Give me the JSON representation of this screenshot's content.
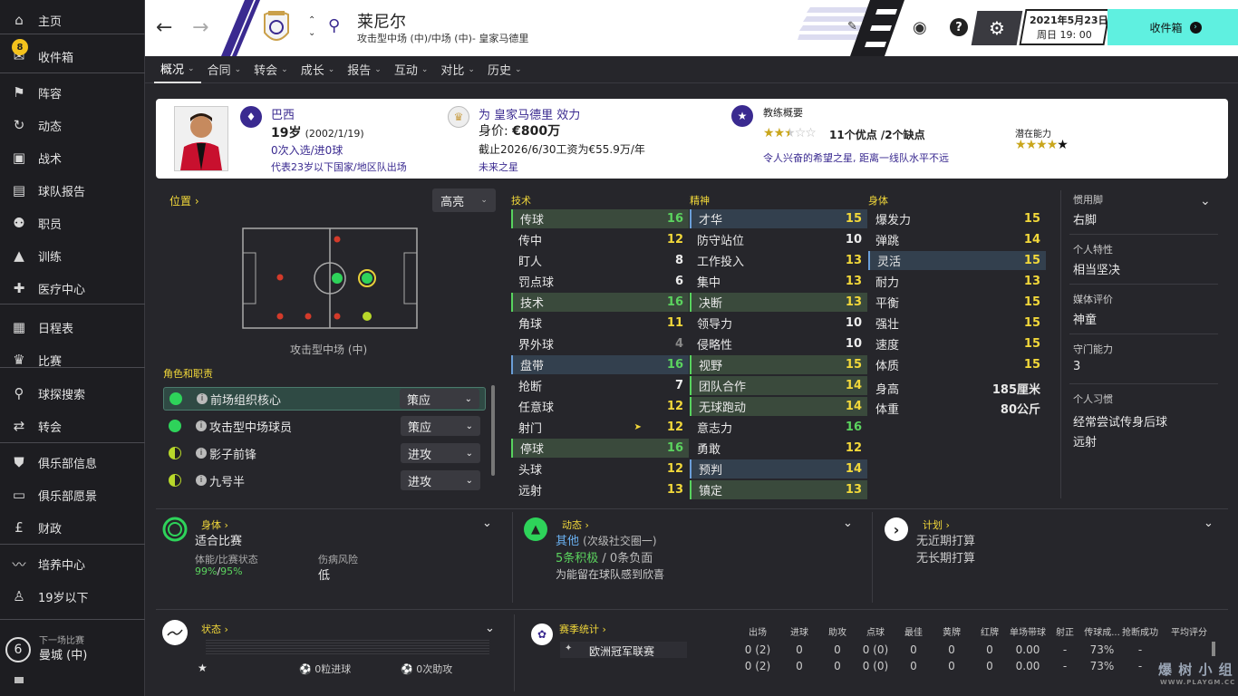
{
  "sidebar": {
    "items": [
      {
        "label": "主页",
        "icon": "home-icon"
      },
      {
        "label": "收件箱",
        "icon": "inbox-icon",
        "badge": "8"
      },
      {
        "label": "阵容",
        "icon": "squad-icon"
      },
      {
        "label": "动态",
        "icon": "dynamics-icon"
      },
      {
        "label": "战术",
        "icon": "tactics-icon"
      },
      {
        "label": "球队报告",
        "icon": "report-icon"
      },
      {
        "label": "职员",
        "icon": "staff-icon"
      },
      {
        "label": "训练",
        "icon": "training-icon"
      },
      {
        "label": "医疗中心",
        "icon": "medical-icon"
      },
      {
        "label": "日程表",
        "icon": "calendar-icon"
      },
      {
        "label": "比赛",
        "icon": "trophy-icon"
      },
      {
        "label": "球探搜索",
        "icon": "search-icon"
      },
      {
        "label": "转会",
        "icon": "transfer-icon"
      },
      {
        "label": "俱乐部信息",
        "icon": "shield-icon"
      },
      {
        "label": "俱乐部愿景",
        "icon": "briefcase-icon"
      },
      {
        "label": "财政",
        "icon": "money-icon"
      },
      {
        "label": "培养中心",
        "icon": "development-icon"
      },
      {
        "label": "19岁以下",
        "icon": "youth-icon"
      }
    ],
    "next_match": {
      "label": "下一场比赛",
      "days": "6",
      "opponent": "曼城 (中)"
    }
  },
  "header": {
    "player_name": "莱尼尔",
    "position_line": "攻击型中场 (中)/中场 (中)- 皇家马德里",
    "date": "2021年5月23日",
    "time": "周日 19: 00",
    "inbox_label": "收件箱"
  },
  "tabs": [
    "概况",
    "合同",
    "转会",
    "成长",
    "报告",
    "互动",
    "对比",
    "历史"
  ],
  "info": {
    "nationality": "巴西",
    "age": "19岁",
    "dob": "(2002/1/19)",
    "caps": "0次入选/进0球",
    "intl": "代表23岁以下国家/地区队出场",
    "club_line": "为 皇家马德里 效力",
    "value_label": "身价: ",
    "value": "€800万",
    "contract": "截止2026/6/30工资为€55.9万/年",
    "future": "未来之星",
    "coach_title": "教练概要",
    "strengths": "11个优点 /2个缺点",
    "coach_note": "令人兴奋的希望之星, 距离一线队水平不远",
    "potential_label": "潜在能力",
    "current_stars": 2.5,
    "potential_stars": 4.5
  },
  "position": {
    "title": "位置",
    "dropdown": "高亮",
    "label": "攻击型中场 (中)",
    "roles_title": "角色和职责",
    "roles": [
      {
        "name": "前场组织核心",
        "duty": "策应",
        "color": "#2ed35a"
      },
      {
        "name": "攻击型中场球员",
        "duty": "策应",
        "color": "#2ed35a"
      },
      {
        "name": "影子前锋",
        "duty": "进攻",
        "color": "#b8d82a"
      },
      {
        "name": "九号半",
        "duty": "进攻",
        "color": "#b8d82a"
      }
    ]
  },
  "attributes": {
    "technical_title": "技术",
    "mental_title": "精神",
    "physical_title": "身体",
    "technical": [
      {
        "n": "传球",
        "v": 16,
        "hl": "g"
      },
      {
        "n": "传中",
        "v": 12
      },
      {
        "n": "盯人",
        "v": 8
      },
      {
        "n": "罚点球",
        "v": 6
      },
      {
        "n": "技术",
        "v": 16,
        "hl": "g"
      },
      {
        "n": "角球",
        "v": 11
      },
      {
        "n": "界外球",
        "v": 4
      },
      {
        "n": "盘带",
        "v": 16,
        "hl": "b"
      },
      {
        "n": "抢断",
        "v": 7
      },
      {
        "n": "任意球",
        "v": 12
      },
      {
        "n": "射门",
        "v": 12,
        "arrow": true
      },
      {
        "n": "停球",
        "v": 16,
        "hl": "g"
      },
      {
        "n": "头球",
        "v": 12
      },
      {
        "n": "远射",
        "v": 13
      }
    ],
    "mental": [
      {
        "n": "才华",
        "v": 15,
        "hl": "b"
      },
      {
        "n": "防守站位",
        "v": 10
      },
      {
        "n": "工作投入",
        "v": 13
      },
      {
        "n": "集中",
        "v": 13
      },
      {
        "n": "决断",
        "v": 13,
        "hl": "g"
      },
      {
        "n": "领导力",
        "v": 10
      },
      {
        "n": "侵略性",
        "v": 10
      },
      {
        "n": "视野",
        "v": 15,
        "hl": "g"
      },
      {
        "n": "团队合作",
        "v": 14,
        "hl": "g"
      },
      {
        "n": "无球跑动",
        "v": 14,
        "hl": "g"
      },
      {
        "n": "意志力",
        "v": 16
      },
      {
        "n": "勇敢",
        "v": 12
      },
      {
        "n": "预判",
        "v": 14,
        "hl": "b"
      },
      {
        "n": "镇定",
        "v": 13,
        "hl": "g"
      }
    ],
    "physical": [
      {
        "n": "爆发力",
        "v": 15
      },
      {
        "n": "弹跳",
        "v": 14
      },
      {
        "n": "灵活",
        "v": 15,
        "hl": "b"
      },
      {
        "n": "耐力",
        "v": 13
      },
      {
        "n": "平衡",
        "v": 15
      },
      {
        "n": "强壮",
        "v": 15
      },
      {
        "n": "速度",
        "v": 15
      },
      {
        "n": "体质",
        "v": 15
      }
    ],
    "height_label": "身高",
    "height": "185厘米",
    "weight_label": "体重",
    "weight": "80公斤"
  },
  "side": [
    {
      "label": "惯用脚",
      "value": "右脚"
    },
    {
      "label": "个人特性",
      "value": "相当坚决"
    },
    {
      "label": "媒体评价",
      "value": "神童"
    },
    {
      "label": "守门能力",
      "value": "3"
    },
    {
      "label": "个人习惯",
      "value": "经常尝试传身后球"
    },
    {
      "label": "",
      "value": "远射"
    }
  ],
  "fitness": {
    "title": "身体",
    "status": "适合比赛",
    "cond_label": "体能/比赛状态",
    "cond_a": "99%",
    "sep": "/",
    "cond_b": "95%",
    "injury_label": "伤病风险",
    "injury": "低"
  },
  "dynamics": {
    "title": "动态",
    "group": "其他",
    "group_note": "(次级社交圈一)",
    "positive": "5条积极",
    "neg": "/ 0条负面",
    "note": "为能留在球队感到欣喜"
  },
  "plans": {
    "title": "计划",
    "p1": "无近期打算",
    "p2": "无长期打算"
  },
  "form": {
    "title": "状态",
    "goals": "0粒进球",
    "assists": "0次助攻"
  },
  "season": {
    "title": "赛季统计",
    "headers": [
      "出场",
      "进球",
      "助攻",
      "点球",
      "最佳",
      "黄牌",
      "红牌",
      "单场带球",
      "射正",
      "传球成...",
      "抢断成功",
      "平均评分"
    ],
    "rows": [
      {
        "comp": "欧洲冠军联赛",
        "vals": [
          "0 (2)",
          "0",
          "0",
          "0 (0)",
          "0",
          "0",
          "0",
          "0.00",
          "-",
          "73%",
          "-",
          ""
        ]
      },
      {
        "comp": "",
        "vals": [
          "0 (2)",
          "0",
          "0",
          "0 (0)",
          "0",
          "0",
          "0",
          "0.00",
          "-",
          "73%",
          "-",
          ""
        ]
      }
    ]
  },
  "watermark": "爆 树 小 组",
  "watermark_url": "WWW.PLAYGM.CC"
}
